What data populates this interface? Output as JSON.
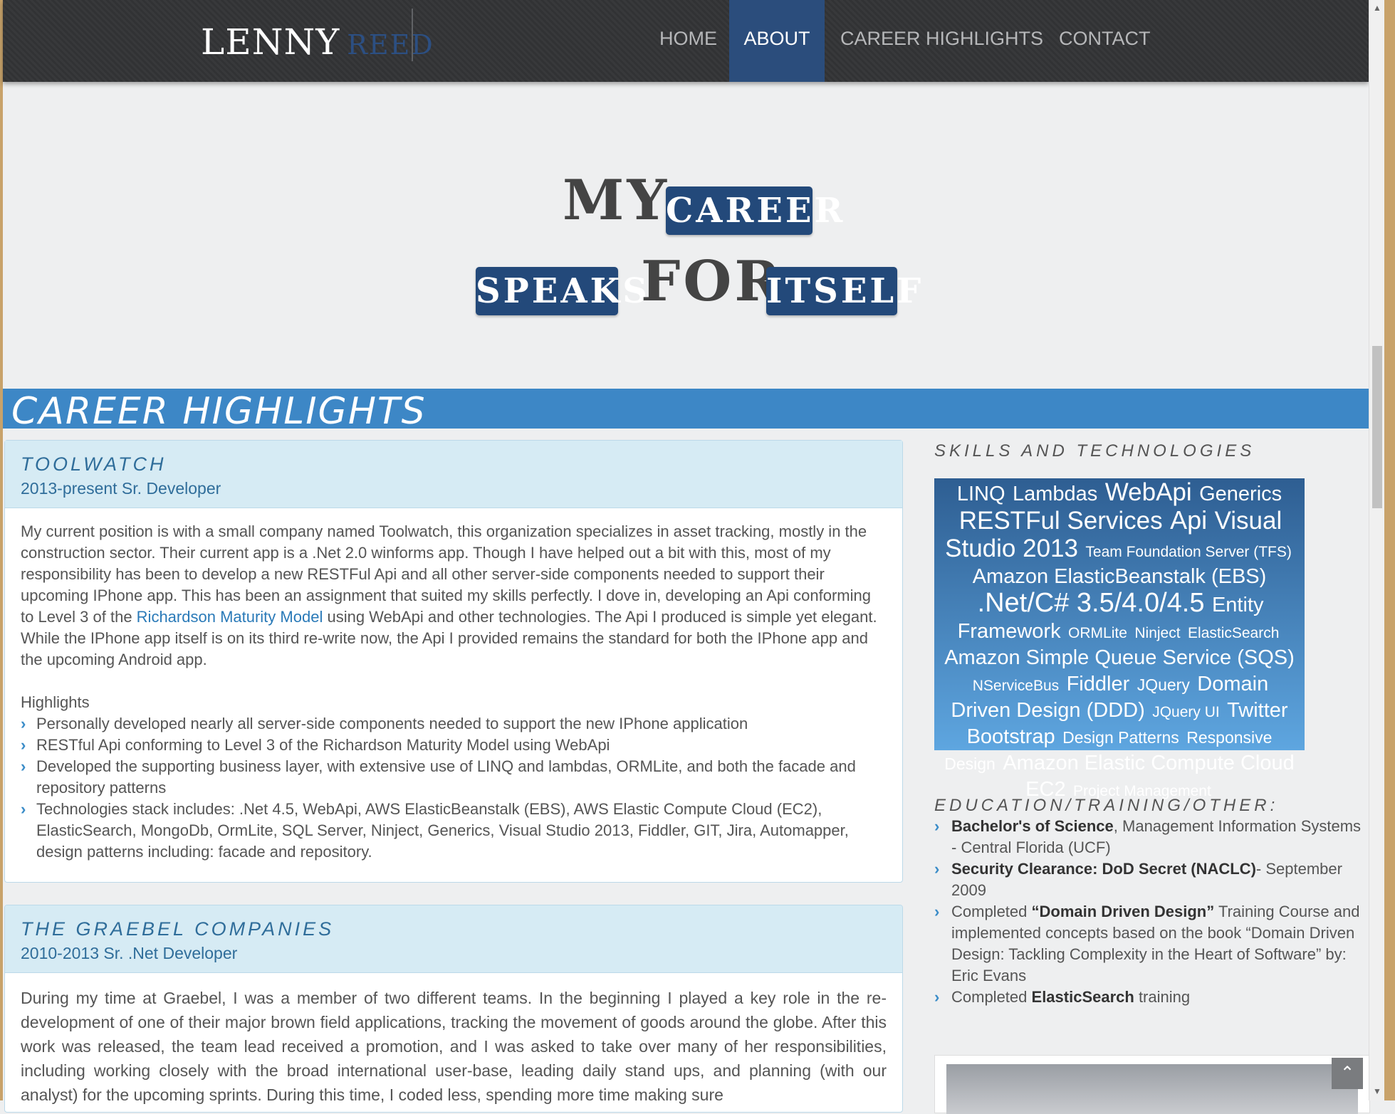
{
  "brand": {
    "first": "LENNY",
    "last": "REED"
  },
  "nav": {
    "home": "HOME",
    "about": "ABOUT",
    "career": "CAREER HIGHLIGHTS",
    "contact": "CONTACT"
  },
  "hero": {
    "w1": "MY",
    "w2": "CAREER",
    "w3": "SPEAKS",
    "w4": "FOR",
    "w5": "ITSELF"
  },
  "section_title": "CAREER HIGHLIGHTS",
  "jobs": [
    {
      "company": "TOOLWATCH",
      "subtitle": "2013-present Sr. Developer",
      "desc_before_link": "My current position is with a small company named Toolwatch, this organization specializes in asset tracking, mostly in the construction sector. Their current app is a .Net 2.0 winforms app. Though I have helped out a bit with this, most of my responsibility has been to develop a new RESTFul Api and all other server-side components needed to support their upcoming IPhone app. This has been an assignment that suited my skills perfectly. I dove in, developing an Api conforming to Level 3 of the ",
      "link": "Richardson Maturity Model",
      "desc_after_link": " using WebApi and other technologies. The Api I produced is simple yet elegant. While the IPhone app itself is on its third re-write now, the Api I provided remains the standard for both the IPhone app and the upcoming Android app.",
      "highlights_label": "Highlights",
      "highlights": [
        "Personally developed nearly all server-side components needed to support the new IPhone application",
        "RESTful Api conforming to Level 3 of the Richardson Maturity Model using WebApi",
        "Developed the supporting business layer, with extensive use of LINQ and lambdas, ORMLite, and both the facade and repository patterns",
        "Technologies stack includes: .Net 4.5, WebApi, AWS ElasticBeanstalk (EBS), AWS Elastic Compute Cloud (EC2), ElasticSearch, MongoDb, OrmLite, SQL Server, Ninject, Generics, Visual Studio 2013, Fiddler, GIT, Jira, Automapper, design patterns including: facade and repository."
      ]
    },
    {
      "company": "THE GRAEBEL COMPANIES",
      "subtitle": "2010-2013 Sr. .Net Developer",
      "desc": "During my time at Graebel, I was a member of two different teams. In the beginning I played a key role in the re-development of one of their major brown field applications, tracking the movement of goods around the globe. After this work was released, the team lead received a promotion, and I was asked to take over many of her responsibilities, including working closely with the broad international user-base, leading daily stand ups, and planning (with our analyst) for the upcoming sprints. During this time, I coded less, spending more time making sure"
    }
  ],
  "skills": {
    "heading": "SKILLS AND TECHNOLOGIES",
    "tags": [
      {
        "t": "LINQ",
        "s": 30
      },
      {
        "t": "Lambdas",
        "s": 30
      },
      {
        "t": "WebApi",
        "s": 36
      },
      {
        "t": "Generics",
        "s": 30
      },
      {
        "t": "RESTFul Services",
        "s": 36
      },
      {
        "t": "Api",
        "s": 38
      },
      {
        "t": "Visual Studio 2013",
        "s": 36
      },
      {
        "t": "Team Foundation Server (TFS)",
        "s": 22
      },
      {
        "t": "Amazon ElasticBeanstalk (EBS)",
        "s": 30
      },
      {
        "t": ".Net/C# 3.5/4.0/4.5",
        "s": 40
      },
      {
        "t": "Entity Framework",
        "s": 30
      },
      {
        "t": "ORMLite",
        "s": 22
      },
      {
        "t": "Ninject",
        "s": 22
      },
      {
        "t": "ElasticSearch",
        "s": 22
      },
      {
        "t": "Amazon Simple Queue Service (SQS)",
        "s": 30
      },
      {
        "t": "NServiceBus",
        "s": 22
      },
      {
        "t": "Fiddler",
        "s": 30
      },
      {
        "t": "JQuery",
        "s": 24
      },
      {
        "t": "Domain Driven Design (DDD)",
        "s": 30
      },
      {
        "t": "JQuery UI",
        "s": 22
      },
      {
        "t": "Twitter Bootstrap",
        "s": 30
      },
      {
        "t": "Design Patterns",
        "s": 24
      },
      {
        "t": "Responsive Design",
        "s": 24
      },
      {
        "t": "Amazon Elastic Compute Cloud EC2",
        "s": 30
      },
      {
        "t": "Project Management",
        "s": 22
      }
    ]
  },
  "education": {
    "heading": "EDUCATION/TRAINING/OTHER:",
    "items": [
      {
        "bold": "Bachelor's of Science",
        "rest": ", Management Information Systems - Central Florida (UCF)",
        "pre": ""
      },
      {
        "bold": "Security Clearance: DoD Secret (NACLC)",
        "rest": "- September 2009",
        "pre": ""
      },
      {
        "pre": "Completed ",
        "bold": "“Domain Driven Design”",
        "rest": " Training Course and implemented concepts based on the book “Domain Driven Design: Tackling Complexity in the Heart of Software” by: Eric Evans"
      },
      {
        "pre": "Completed ",
        "bold": "ElasticSearch",
        "rest": " training"
      }
    ]
  },
  "icons": {
    "chevron": "chevron-right-icon",
    "to_top": "arrow-up-icon"
  },
  "colors": {
    "nav_active": "#2b4d7c",
    "section_bar": "#3d87c6",
    "hero_box": "#23497a",
    "link": "#2a7ab8"
  }
}
